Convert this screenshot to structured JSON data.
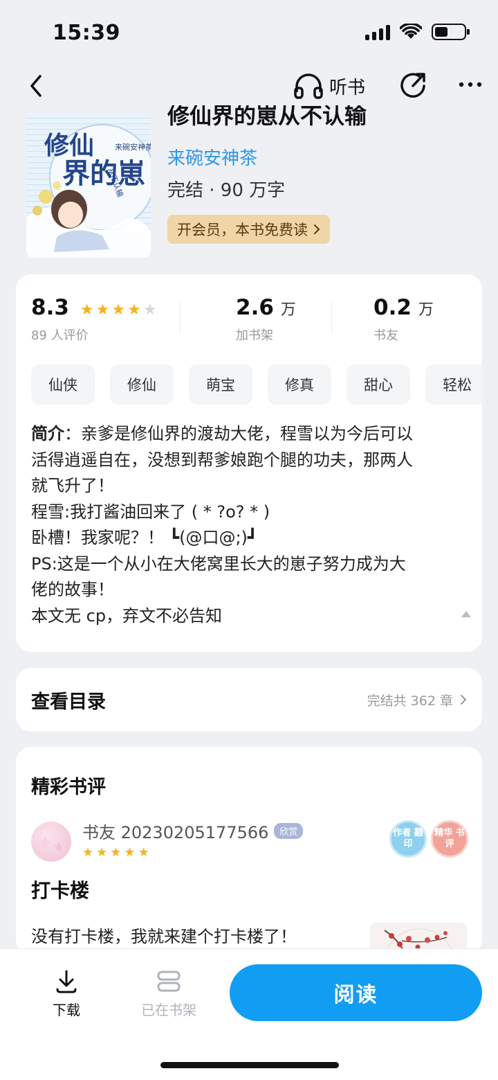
{
  "status_bar": {
    "time": "15:39"
  },
  "nav": {
    "listen_label": "听书"
  },
  "book": {
    "title": "修仙界的崽从不认输",
    "author": "来碗安神茶",
    "status": "完结 · 90 万字",
    "vip_promo": "开会员，本书免费读",
    "cover_title": "修仙界的崽",
    "cover_subtitle": "从不认输",
    "cover_author": "来碗安神茶"
  },
  "stats": {
    "rating": "8.3",
    "rating_stars": 4,
    "rating_count": "89 人评价",
    "shelf_value": "2.6",
    "shelf_unit": "万",
    "shelf_label": "加书架",
    "friends_value": "0.2",
    "friends_unit": "万",
    "friends_label": "书友"
  },
  "tags": [
    "仙侠",
    "修仙",
    "萌宝",
    "修真",
    "甜心",
    "轻松"
  ],
  "intro": {
    "label": "简介",
    "sep": "：",
    "lines": [
      "亲爹是修仙界的渡劫大佬，程雪以为今后可以",
      "活得逍遥自在，没想到帮爹娘跑个腿的功夫，那两人",
      "就飞升了！",
      "程雪:我打酱油回来了 ( * ?o? * )",
      "卧槽！我家呢？！ ┗(@口@;)┛",
      "PS:这是一个从小在大佬窝里长大的崽子努力成为大",
      "佬的故事！",
      "本文无 cp，弃文不必告知"
    ]
  },
  "toc": {
    "title": "查看目录",
    "info": "完结共 362 章"
  },
  "reviews": {
    "heading": "精彩书评",
    "username": "书友 20230205177566",
    "level": "欣赏",
    "stars": 5,
    "badge_author": "作者 翻印",
    "badge_featured": "精华 书评",
    "title": "打卡楼",
    "text": "没有打卡楼，我就来建个打卡楼了！"
  },
  "bottom": {
    "download_label": "下载",
    "shelf_label": "已在书架",
    "read_label": "阅读"
  },
  "colors": {
    "accent": "#119ef2",
    "author_link": "#2f96e8",
    "star": "#f6b31c",
    "vip_bg": "#f0d6a6"
  }
}
